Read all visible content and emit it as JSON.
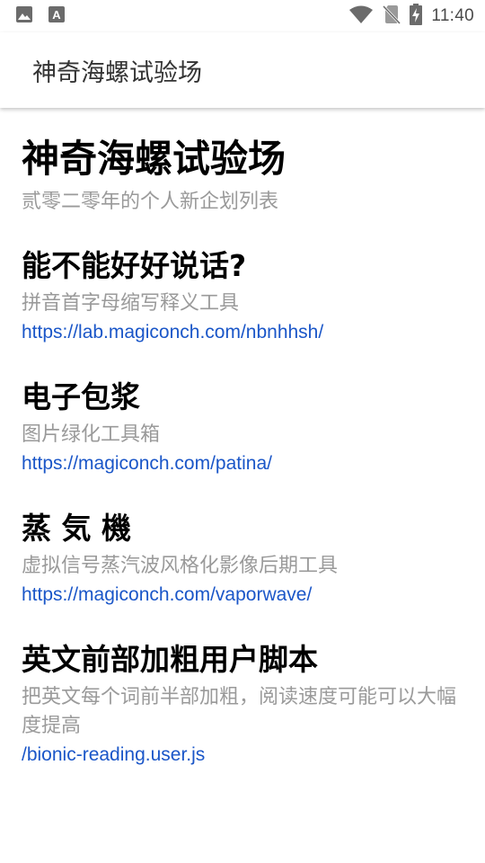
{
  "status_bar": {
    "time": "11:40",
    "icons": [
      "image-icon",
      "font-icon",
      "wifi-icon",
      "no-sim-icon",
      "battery-charging-icon"
    ]
  },
  "app_bar": {
    "title": "神奇海螺试验场"
  },
  "hero": {
    "title": "神奇海螺试验场",
    "subtitle": "贰零二零年的个人新企划列表"
  },
  "items": [
    {
      "title": "能不能好好说话?",
      "description": "拼音首字母缩写释义工具",
      "link": "https://lab.magiconch.com/nbnhhsh/"
    },
    {
      "title": "电子包浆",
      "description": "图片绿化工具箱",
      "link": "https://magiconch.com/patina/"
    },
    {
      "title": "蒸 気 機",
      "description": "虚拟信号蒸汽波风格化影像后期工具",
      "link": "https://magiconch.com/vaporwave/"
    },
    {
      "title": "英文前部加粗用户脚本",
      "description": "把英文每个词前半部加粗，阅读速度可能可以大幅度提高",
      "link": "/bionic-reading.user.js"
    }
  ],
  "colors": {
    "link": "#1a56c8",
    "muted_text": "#9a9a9a",
    "status_icon": "#6b6b6b"
  }
}
